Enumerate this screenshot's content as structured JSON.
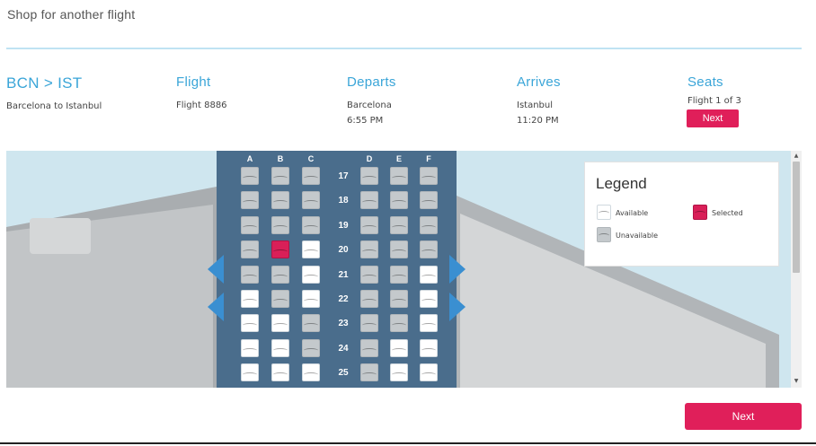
{
  "shop_link": "Shop for another flight",
  "summary": {
    "route": {
      "title": "BCN > IST",
      "desc": "Barcelona to Istanbul"
    },
    "flight": {
      "header": "Flight",
      "value": "Flight 8886"
    },
    "departs": {
      "header": "Departs",
      "city": "Barcelona",
      "time": "6:55 PM"
    },
    "arrives": {
      "header": "Arrives",
      "city": "Istanbul",
      "time": "11:20 PM"
    },
    "seats": {
      "header": "Seats",
      "progress": "Flight 1 of 3",
      "next_label": "Next"
    }
  },
  "seat_map": {
    "columns_left": [
      "A",
      "B",
      "C"
    ],
    "columns_right": [
      "D",
      "E",
      "F"
    ],
    "rows": [
      {
        "number": "17",
        "seats": [
          "unavailable",
          "unavailable",
          "unavailable",
          "unavailable",
          "unavailable",
          "unavailable"
        ]
      },
      {
        "number": "18",
        "seats": [
          "unavailable",
          "unavailable",
          "unavailable",
          "unavailable",
          "unavailable",
          "unavailable"
        ]
      },
      {
        "number": "19",
        "seats": [
          "unavailable",
          "unavailable",
          "unavailable",
          "unavailable",
          "unavailable",
          "unavailable"
        ]
      },
      {
        "number": "20",
        "seats": [
          "unavailable",
          "selected",
          "available",
          "unavailable",
          "unavailable",
          "unavailable"
        ]
      },
      {
        "number": "21",
        "seats": [
          "unavailable",
          "unavailable",
          "available",
          "unavailable",
          "unavailable",
          "available"
        ]
      },
      {
        "number": "22",
        "seats": [
          "available",
          "unavailable",
          "available",
          "unavailable",
          "unavailable",
          "available"
        ]
      },
      {
        "number": "23",
        "seats": [
          "available",
          "available",
          "unavailable",
          "unavailable",
          "unavailable",
          "available"
        ]
      },
      {
        "number": "24",
        "seats": [
          "available",
          "available",
          "unavailable",
          "unavailable",
          "available",
          "available"
        ]
      },
      {
        "number": "25",
        "seats": [
          "available",
          "available",
          "available",
          "unavailable",
          "available",
          "available"
        ]
      }
    ],
    "legend": {
      "title": "Legend",
      "available": "Available",
      "selected": "Selected",
      "unavailable": "Unavailable"
    }
  },
  "next_button": "Next",
  "colors": {
    "accent": "#e01f5a",
    "heading": "#3aa5d8",
    "fuselage": "#4a6d8c",
    "arrow": "#3a8fd1"
  }
}
